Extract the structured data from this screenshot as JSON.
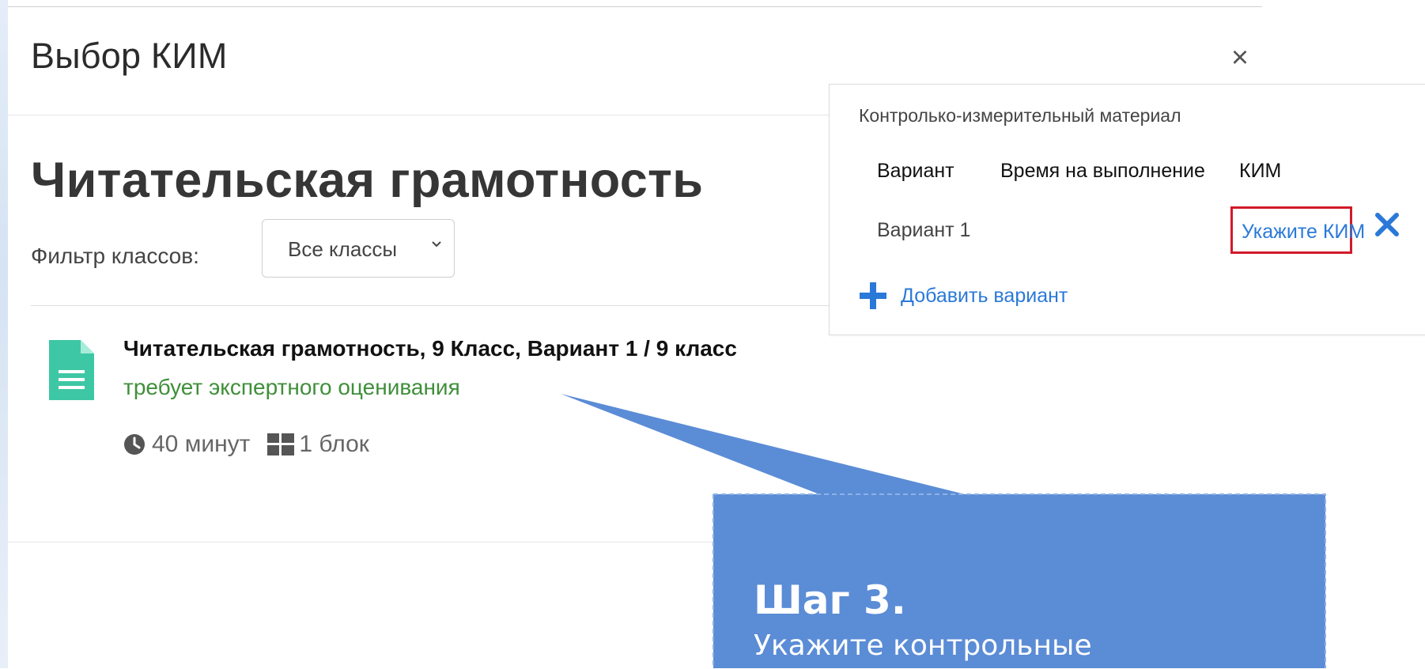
{
  "modal": {
    "title": "Выбор КИМ",
    "close_label": "×"
  },
  "main": {
    "page_title": "Читательская грамотность",
    "filter_label": "Фильтр классов:",
    "filter_value": "Все классы",
    "items": [
      {
        "title": "Читательская грамотность, 9 Класс, Вариант 1 / 9 класс",
        "subtitle": "требует экспертного оценивания",
        "duration": "40 минут",
        "blocks": "1 блок"
      }
    ]
  },
  "kim_panel": {
    "title": "Контролько-измерительный материал",
    "columns": [
      "Вариант",
      "Время на выполнение",
      "КИМ"
    ],
    "rows": [
      {
        "variant": "Вариант 1",
        "kim_link": "Укажите КИМ"
      }
    ],
    "add_variant": "Добавить вариант"
  },
  "callout": {
    "heading": "Шаг 3.",
    "body": "Укажите контрольные",
    "color": "#5b8cd6"
  },
  "colors": {
    "accent": "#2a79d8",
    "doc_icon": "#3ec7a5",
    "status_green": "#3f8f3a",
    "highlight_red": "#d11a2a"
  },
  "icons": {
    "close": "close-icon",
    "doc": "document-icon",
    "clock": "clock-icon",
    "blocks": "blocks-icon",
    "remove": "remove-icon",
    "plus": "plus-icon",
    "chevron": "chevron-down-icon"
  }
}
